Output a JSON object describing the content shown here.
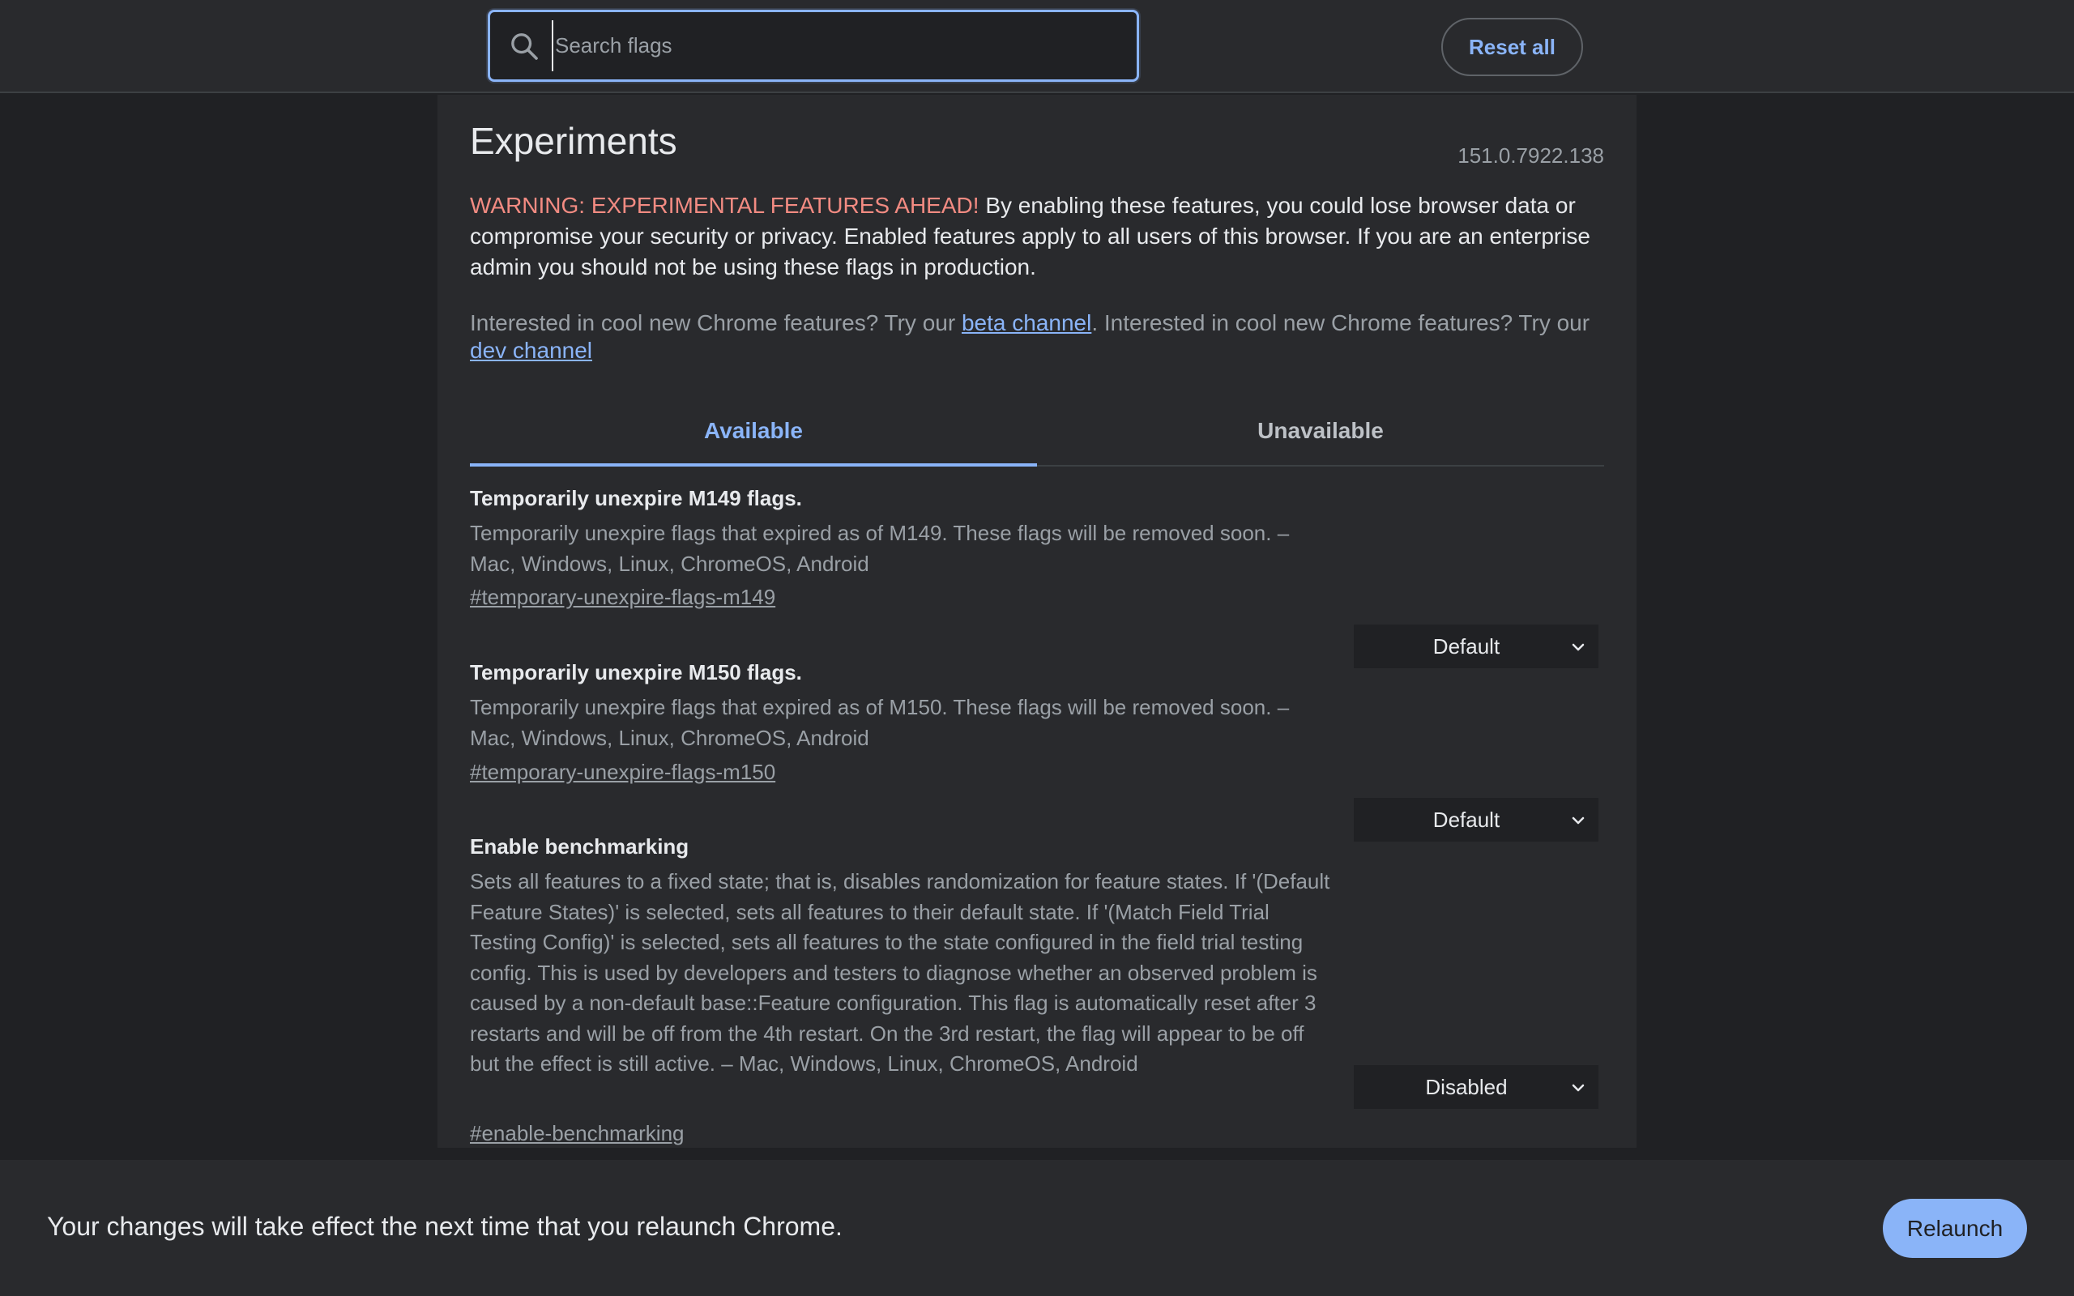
{
  "header": {
    "search": {
      "placeholder": "Search flags",
      "value": ""
    },
    "reset_label": "Reset all"
  },
  "main": {
    "title": "Experiments",
    "version": "151.0.7922.138",
    "warning_prefix": "WARNING: EXPERIMENTAL FEATURES AHEAD!",
    "warning_text": " By enabling these features, you could lose browser data or compromise your security or privacy. Enabled features apply to all users of this browser. If you are an enterprise admin you should not be using these flags in production.",
    "promo": {
      "text1": "Interested in cool new Chrome features? Try our ",
      "beta_link": "beta channel",
      "text2": ". Interested in cool new Chrome features? Try our ",
      "dev_link": "dev channel"
    },
    "tabs": [
      {
        "label": "Available",
        "active": true
      },
      {
        "label": "Unavailable",
        "active": false
      }
    ],
    "flags": [
      {
        "title": "Temporarily unexpire M149 flags.",
        "description": "Temporarily unexpire flags that expired as of M149. These flags will be removed soon. – Mac, Windows, Linux, ChromeOS, Android",
        "link": "#temporary-unexpire-flags-m149",
        "value": "Default"
      },
      {
        "title": "Temporarily unexpire M150 flags.",
        "description": "Temporarily unexpire flags that expired as of M150. These flags will be removed soon. – Mac, Windows, Linux, ChromeOS, Android",
        "link": "#temporary-unexpire-flags-m150",
        "value": "Default"
      },
      {
        "title": "Enable benchmarking",
        "description": "Sets all features to a fixed state; that is, disables randomization for feature states. If '(Default Feature States)' is selected, sets all features to their default state. If '(Match Field Trial Testing Config)' is selected, sets all features to the state configured in the field trial testing config. This is used by developers and testers to diagnose whether an observed problem is caused by a non-default base::Feature configuration. This flag is automatically reset after 3 restarts and will be off from the 4th restart. On the 3rd restart, the flag will appear to be off but the effect is still active. – Mac, Windows, Linux, ChromeOS, Android",
        "link": "#enable-benchmarking",
        "value": "Disabled"
      }
    ]
  },
  "footer": {
    "message": "Your changes will take effect the next time that you relaunch Chrome.",
    "relaunch_label": "Relaunch"
  },
  "colors": {
    "accent": "#8ab4f8",
    "warning": "#f28b82",
    "background": "#202124",
    "surface": "#292a2d"
  },
  "icons": {
    "search": "search-icon",
    "dropdown": "chevron-down-icon"
  }
}
